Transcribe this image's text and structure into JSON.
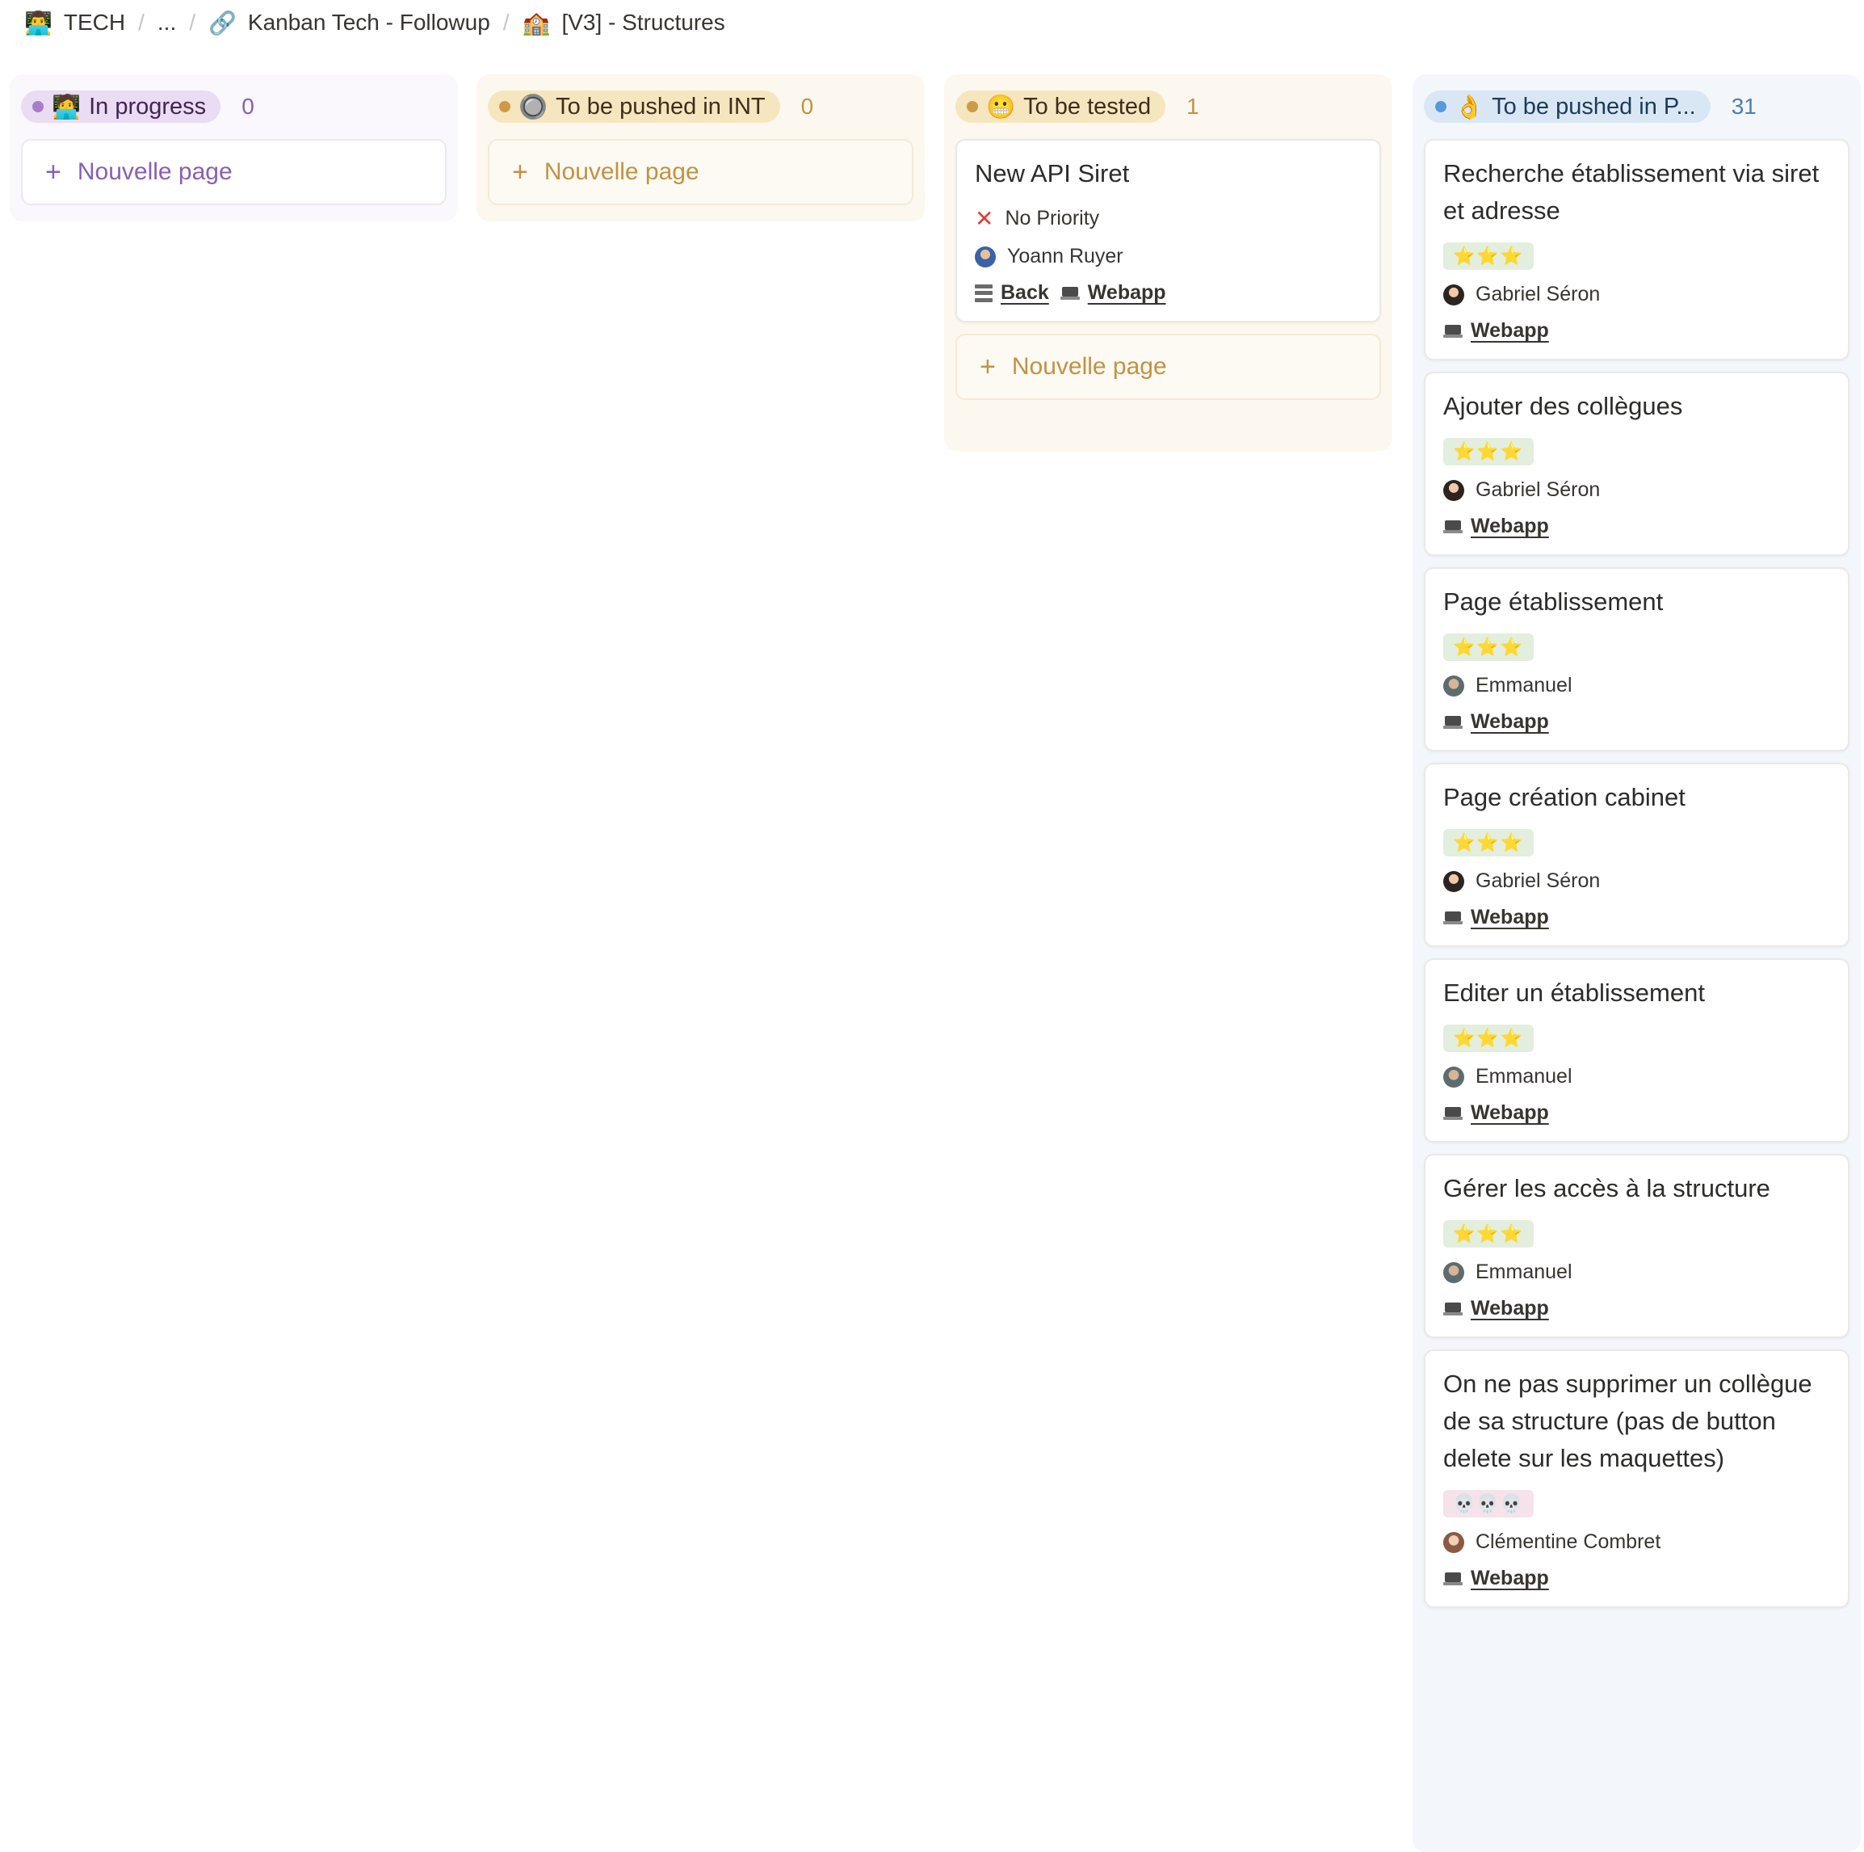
{
  "breadcrumb": {
    "items": [
      {
        "icon": "👨‍💻",
        "label": "TECH"
      },
      {
        "label": "..."
      },
      {
        "icon": "🔗",
        "label": "Kanban Tech - Followup"
      },
      {
        "icon": "🏫",
        "label": "[V3] - Structures"
      }
    ],
    "separator": "/"
  },
  "columns": [
    {
      "label": "In progress",
      "icon": "🧑‍💻",
      "count": "0",
      "new_page": "Nouvelle page"
    },
    {
      "label": "To be pushed in INT",
      "icon": "🔘",
      "count": "0",
      "new_page": "Nouvelle page"
    },
    {
      "label": "To be tested",
      "icon": "😬",
      "count": "1",
      "new_page": "Nouvelle page"
    },
    {
      "label": "To be pushed in P...",
      "icon": "👌",
      "count": "31"
    }
  ],
  "tested_card": {
    "title": "New API Siret",
    "priority": "No Priority",
    "assignee": "Yoann Ruyer",
    "tags": [
      "Back",
      "Webapp"
    ]
  },
  "prod_cards": [
    {
      "title": "Recherche établissement via siret et adresse",
      "rating": "⭐⭐⭐",
      "assignee": "Gabriel Séron",
      "tag": "Webapp"
    },
    {
      "title": "Ajouter des collègues",
      "rating": "⭐⭐⭐",
      "assignee": "Gabriel Séron",
      "tag": "Webapp"
    },
    {
      "title": "Page établissement",
      "rating": "⭐⭐⭐",
      "assignee": "Emmanuel",
      "tag": "Webapp"
    },
    {
      "title": "Page création cabinet",
      "rating": "⭐⭐⭐",
      "assignee": "Gabriel Séron",
      "tag": "Webapp"
    },
    {
      "title": "Editer un établissement",
      "rating": "⭐⭐⭐",
      "assignee": "Emmanuel",
      "tag": "Webapp"
    },
    {
      "title": "Gérer les accès à la structure",
      "rating": "⭐⭐⭐",
      "assignee": "Emmanuel",
      "tag": "Webapp"
    },
    {
      "title": "On ne pas  supprimer un collègue de sa structure (pas de button delete sur les maquettes)",
      "rating": "💀💀💀",
      "assignee": "Clémentine Combret",
      "tag": "Webapp"
    }
  ],
  "colors": {
    "purple_pill": "#eadcf3",
    "yellow_pill": "#f5e6bf",
    "blue_pill": "#d9e7f5",
    "stars_badge": "#e3eede",
    "skulls_badge": "#f6e2ea"
  }
}
